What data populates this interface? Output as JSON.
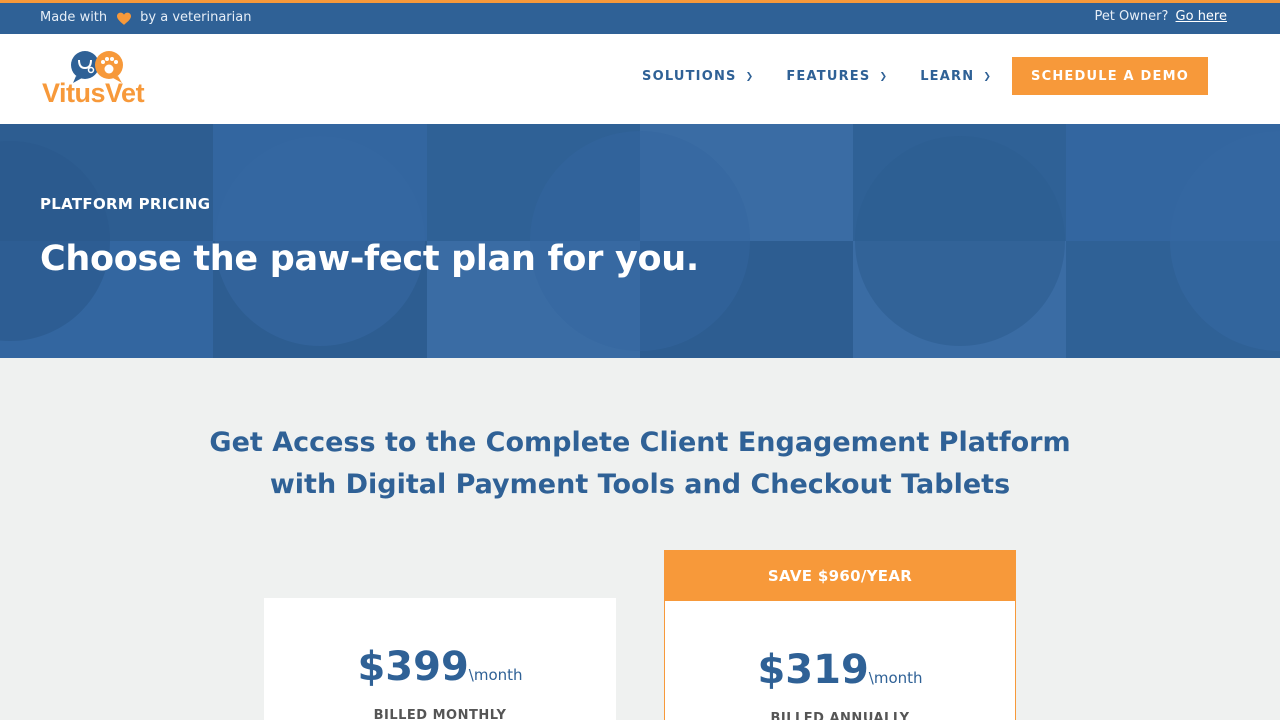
{
  "topbar": {
    "made_with": "Made with",
    "by_vet": "by a veterinarian",
    "pet_owner": "Pet Owner?",
    "go_here": "Go here"
  },
  "logo": {
    "part1": "Vitus",
    "part2": "Vet"
  },
  "nav": {
    "solutions": "SOLUTIONS",
    "features": "FEATURES",
    "learn": "LEARN",
    "demo": "SCHEDULE A DEMO"
  },
  "hero": {
    "eyebrow": "PLATFORM PRICING",
    "title": "Choose the paw-fect plan for you."
  },
  "section": {
    "line1": "Get Access to the Complete Client Engagement Platform",
    "line2": "with Digital Payment Tools and Checkout Tablets"
  },
  "plans": {
    "monthly": {
      "price": "$399",
      "per": "\\month",
      "billing": "BILLED MONTHLY"
    },
    "annual": {
      "banner": "SAVE $960/YEAR",
      "price": "$319",
      "per": "\\month",
      "billing": "BILLED ANNUALLY"
    }
  },
  "colors": {
    "brand_blue": "#2f6196",
    "accent_orange": "#f7993a",
    "background": "#eff1f0"
  },
  "icons": {
    "heart": "heart-icon",
    "chevron": "chevron-down-icon"
  }
}
